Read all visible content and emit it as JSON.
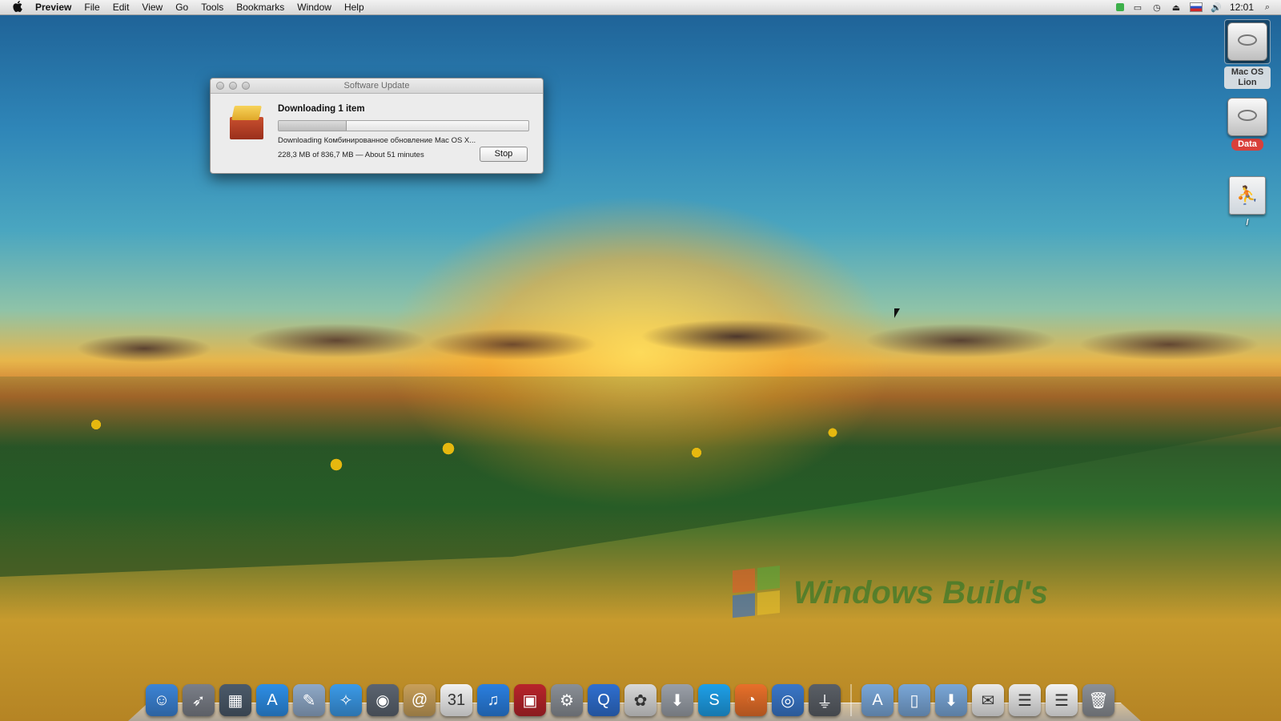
{
  "menubar": {
    "apple": "",
    "app_name": "Preview",
    "menus": [
      "File",
      "Edit",
      "View",
      "Go",
      "Tools",
      "Bookmarks",
      "Window",
      "Help"
    ],
    "clock": "12:01"
  },
  "desktop_icons": [
    {
      "label": "Mac OS Lion"
    },
    {
      "label": "Data"
    },
    {
      "label": "/"
    }
  ],
  "window": {
    "title": "Software Update",
    "heading": "Downloading 1 item",
    "progress_fraction": 0.27,
    "status_text": "Downloading Комбинированное обновление Mac OS X...",
    "size_text": "228,3 MB of 836,7 MB — About 51 minutes",
    "stop_label": "Stop"
  },
  "watermark": "Windows Build's",
  "dock": {
    "apps": [
      {
        "name": "finder-icon",
        "glyph": "☺",
        "color": "#3c84d6"
      },
      {
        "name": "launchpad-icon",
        "glyph": "➶",
        "color": "#7b7f88"
      },
      {
        "name": "mission-control-icon",
        "glyph": "▦",
        "color": "#4b5a6a"
      },
      {
        "name": "app-store-icon",
        "glyph": "A",
        "color": "#2d8ee6"
      },
      {
        "name": "preview-icon",
        "glyph": "✎",
        "color": "#8fa9c8"
      },
      {
        "name": "safari-icon",
        "glyph": "✧",
        "color": "#3b9ae8"
      },
      {
        "name": "facetime-icon",
        "glyph": "◉",
        "color": "#5b6470"
      },
      {
        "name": "address-book-icon",
        "glyph": "@",
        "color": "#c8a05a"
      },
      {
        "name": "ical-icon",
        "glyph": "31",
        "color": "#f2f2f2"
      },
      {
        "name": "itunes-icon",
        "glyph": "♫",
        "color": "#2a7fe0"
      },
      {
        "name": "photo-booth-icon",
        "glyph": "▣",
        "color": "#b8242a"
      },
      {
        "name": "system-preferences-icon",
        "glyph": "⚙",
        "color": "#8a8f96"
      },
      {
        "name": "quicktime-icon",
        "glyph": "Q",
        "color": "#2f6fd0"
      },
      {
        "name": "iphoto-icon",
        "glyph": "✿",
        "color": "#d9d9d9"
      },
      {
        "name": "installer-icon",
        "glyph": "⬇",
        "color": "#9aa0a8"
      },
      {
        "name": "skype-icon",
        "glyph": "S",
        "color": "#1ea0e8"
      },
      {
        "name": "firefox-icon",
        "glyph": "◔",
        "color": "#e8702a"
      },
      {
        "name": "network-utility-icon",
        "glyph": "◎",
        "color": "#3a77c9"
      },
      {
        "name": "usb-icon",
        "glyph": "⏚",
        "color": "#5a5f66"
      }
    ],
    "folders": [
      {
        "name": "applications-folder-icon",
        "glyph": "A",
        "color": "#7aa7d8"
      },
      {
        "name": "documents-folder-icon",
        "glyph": "▯",
        "color": "#7aa7d8"
      },
      {
        "name": "downloads-folder-icon",
        "glyph": "⬇",
        "color": "#7aa7d8"
      },
      {
        "name": "itunes-stack-icon",
        "glyph": "✉",
        "color": "#eaeaea"
      },
      {
        "name": "firefox-stack-icon",
        "glyph": "☰",
        "color": "#eaeaea"
      },
      {
        "name": "skype-stack-icon",
        "glyph": "☰",
        "color": "#f4f4f4"
      },
      {
        "name": "trash-icon",
        "glyph": "🗑",
        "color": "#8c9096"
      }
    ]
  }
}
